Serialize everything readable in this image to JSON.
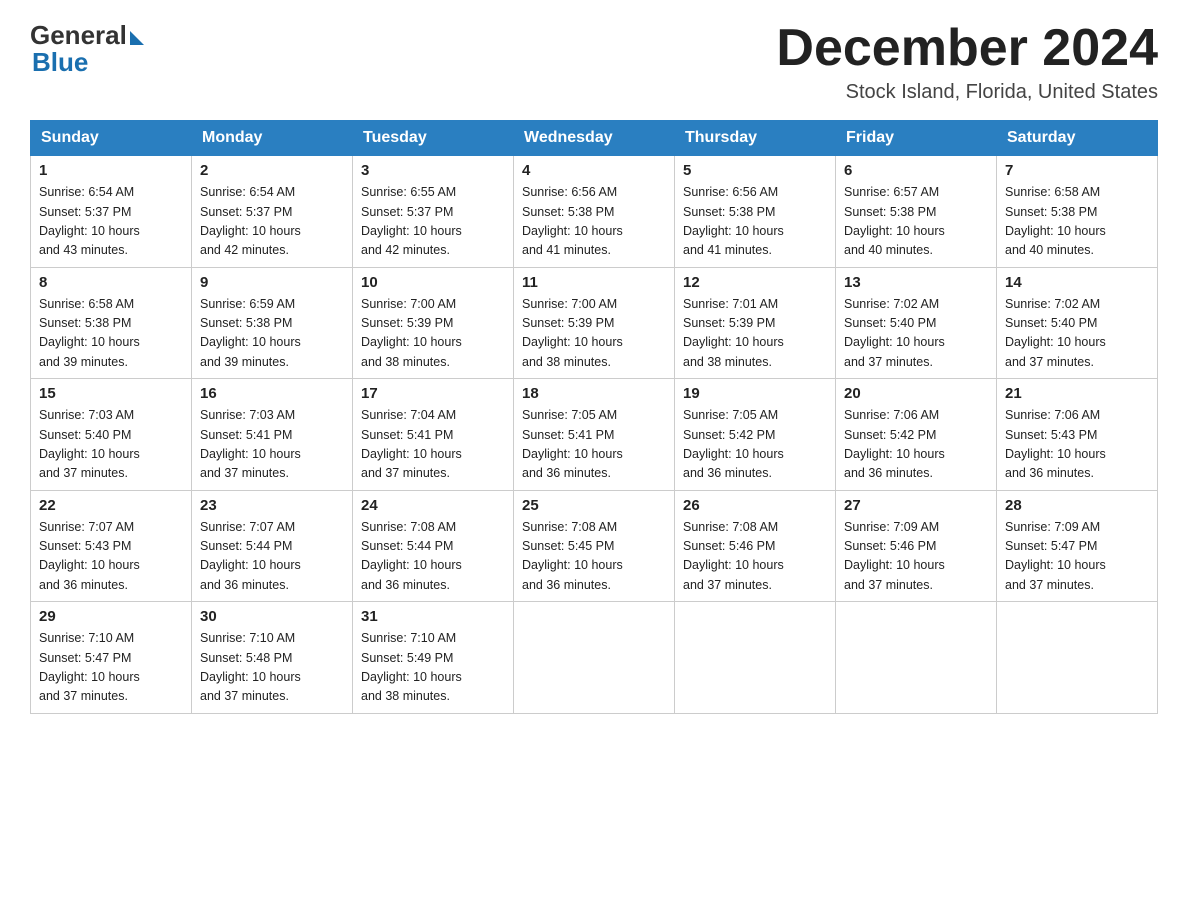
{
  "header": {
    "logo_general": "General",
    "logo_blue": "Blue",
    "month_title": "December 2024",
    "location": "Stock Island, Florida, United States"
  },
  "days_of_week": [
    "Sunday",
    "Monday",
    "Tuesday",
    "Wednesday",
    "Thursday",
    "Friday",
    "Saturday"
  ],
  "weeks": [
    [
      {
        "day": "1",
        "sunrise": "6:54 AM",
        "sunset": "5:37 PM",
        "daylight": "10 hours and 43 minutes."
      },
      {
        "day": "2",
        "sunrise": "6:54 AM",
        "sunset": "5:37 PM",
        "daylight": "10 hours and 42 minutes."
      },
      {
        "day": "3",
        "sunrise": "6:55 AM",
        "sunset": "5:37 PM",
        "daylight": "10 hours and 42 minutes."
      },
      {
        "day": "4",
        "sunrise": "6:56 AM",
        "sunset": "5:38 PM",
        "daylight": "10 hours and 41 minutes."
      },
      {
        "day": "5",
        "sunrise": "6:56 AM",
        "sunset": "5:38 PM",
        "daylight": "10 hours and 41 minutes."
      },
      {
        "day": "6",
        "sunrise": "6:57 AM",
        "sunset": "5:38 PM",
        "daylight": "10 hours and 40 minutes."
      },
      {
        "day": "7",
        "sunrise": "6:58 AM",
        "sunset": "5:38 PM",
        "daylight": "10 hours and 40 minutes."
      }
    ],
    [
      {
        "day": "8",
        "sunrise": "6:58 AM",
        "sunset": "5:38 PM",
        "daylight": "10 hours and 39 minutes."
      },
      {
        "day": "9",
        "sunrise": "6:59 AM",
        "sunset": "5:38 PM",
        "daylight": "10 hours and 39 minutes."
      },
      {
        "day": "10",
        "sunrise": "7:00 AM",
        "sunset": "5:39 PM",
        "daylight": "10 hours and 38 minutes."
      },
      {
        "day": "11",
        "sunrise": "7:00 AM",
        "sunset": "5:39 PM",
        "daylight": "10 hours and 38 minutes."
      },
      {
        "day": "12",
        "sunrise": "7:01 AM",
        "sunset": "5:39 PM",
        "daylight": "10 hours and 38 minutes."
      },
      {
        "day": "13",
        "sunrise": "7:02 AM",
        "sunset": "5:40 PM",
        "daylight": "10 hours and 37 minutes."
      },
      {
        "day": "14",
        "sunrise": "7:02 AM",
        "sunset": "5:40 PM",
        "daylight": "10 hours and 37 minutes."
      }
    ],
    [
      {
        "day": "15",
        "sunrise": "7:03 AM",
        "sunset": "5:40 PM",
        "daylight": "10 hours and 37 minutes."
      },
      {
        "day": "16",
        "sunrise": "7:03 AM",
        "sunset": "5:41 PM",
        "daylight": "10 hours and 37 minutes."
      },
      {
        "day": "17",
        "sunrise": "7:04 AM",
        "sunset": "5:41 PM",
        "daylight": "10 hours and 37 minutes."
      },
      {
        "day": "18",
        "sunrise": "7:05 AM",
        "sunset": "5:41 PM",
        "daylight": "10 hours and 36 minutes."
      },
      {
        "day": "19",
        "sunrise": "7:05 AM",
        "sunset": "5:42 PM",
        "daylight": "10 hours and 36 minutes."
      },
      {
        "day": "20",
        "sunrise": "7:06 AM",
        "sunset": "5:42 PM",
        "daylight": "10 hours and 36 minutes."
      },
      {
        "day": "21",
        "sunrise": "7:06 AM",
        "sunset": "5:43 PM",
        "daylight": "10 hours and 36 minutes."
      }
    ],
    [
      {
        "day": "22",
        "sunrise": "7:07 AM",
        "sunset": "5:43 PM",
        "daylight": "10 hours and 36 minutes."
      },
      {
        "day": "23",
        "sunrise": "7:07 AM",
        "sunset": "5:44 PM",
        "daylight": "10 hours and 36 minutes."
      },
      {
        "day": "24",
        "sunrise": "7:08 AM",
        "sunset": "5:44 PM",
        "daylight": "10 hours and 36 minutes."
      },
      {
        "day": "25",
        "sunrise": "7:08 AM",
        "sunset": "5:45 PM",
        "daylight": "10 hours and 36 minutes."
      },
      {
        "day": "26",
        "sunrise": "7:08 AM",
        "sunset": "5:46 PM",
        "daylight": "10 hours and 37 minutes."
      },
      {
        "day": "27",
        "sunrise": "7:09 AM",
        "sunset": "5:46 PM",
        "daylight": "10 hours and 37 minutes."
      },
      {
        "day": "28",
        "sunrise": "7:09 AM",
        "sunset": "5:47 PM",
        "daylight": "10 hours and 37 minutes."
      }
    ],
    [
      {
        "day": "29",
        "sunrise": "7:10 AM",
        "sunset": "5:47 PM",
        "daylight": "10 hours and 37 minutes."
      },
      {
        "day": "30",
        "sunrise": "7:10 AM",
        "sunset": "5:48 PM",
        "daylight": "10 hours and 37 minutes."
      },
      {
        "day": "31",
        "sunrise": "7:10 AM",
        "sunset": "5:49 PM",
        "daylight": "10 hours and 38 minutes."
      },
      null,
      null,
      null,
      null
    ]
  ],
  "cell_labels": {
    "sunrise": "Sunrise:",
    "sunset": "Sunset:",
    "daylight": "Daylight:"
  }
}
